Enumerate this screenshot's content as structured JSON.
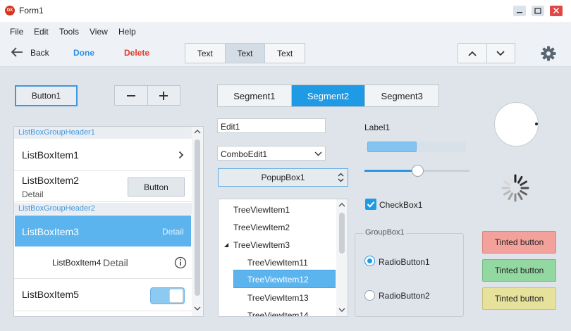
{
  "window": {
    "title": "Form1",
    "app_icon_text": "DX"
  },
  "menu": [
    "File",
    "Edit",
    "Tools",
    "View",
    "Help"
  ],
  "toolbar": {
    "back_label": "Back",
    "done_label": "Done",
    "delete_label": "Delete",
    "text_segments": [
      "Text",
      "Text",
      "Text"
    ],
    "selected_text_segment": 1,
    "accent_color": "#2b8fe3",
    "delete_color": "#e23a2a"
  },
  "controls": {
    "button1_label": "Button1",
    "spin_minus": "−",
    "spin_plus": "+"
  },
  "listbox": {
    "group_header_1": "ListBoxGroupHeader1",
    "group_header_2": "ListBoxGroupHeader2",
    "item1": "ListBoxItem1",
    "item2": "ListBoxItem2",
    "item2_detail": "Detail",
    "item2_button": "Button",
    "item3": "ListBoxItem3",
    "item3_detail": "Detail",
    "item4": "ListBoxItem4",
    "item4_detail": "Detail",
    "item5": "ListBoxItem5",
    "item5_toggle_on": true,
    "selected_item": "ListBoxItem3"
  },
  "segments": {
    "items": [
      "Segment1",
      "Segment2",
      "Segment3"
    ],
    "active_index": 1,
    "active_color": "#1f9be6"
  },
  "inputs": {
    "edit1_value": "Edit1",
    "combo1_value": "ComboEdit1",
    "popup1_value": "PopupBox1"
  },
  "tree": {
    "items": [
      "TreeViewItem1",
      "TreeViewItem2",
      "TreeViewItem3",
      "TreeViewItem11",
      "TreeViewItem12",
      "TreeViewItem13",
      "TreeViewItem14"
    ],
    "expand_glyph": "◢",
    "selected_item": "TreeViewItem12"
  },
  "label1": "Label1",
  "progress_fraction": 0.5,
  "slider_fraction": 0.5,
  "checkbox": {
    "label": "CheckBox1",
    "checked": true
  },
  "groupbox": {
    "label": "GroupBox1",
    "radio1_label": "RadioButton1",
    "radio1_checked": true,
    "radio2_label": "RadioButton2",
    "radio2_checked": false
  },
  "tinted_buttons": [
    {
      "label": "Tinted button",
      "color": "#f3a19b"
    },
    {
      "label": "Tinted button",
      "color": "#93d7a1"
    },
    {
      "label": "Tinted button",
      "color": "#e6e19b"
    }
  ]
}
